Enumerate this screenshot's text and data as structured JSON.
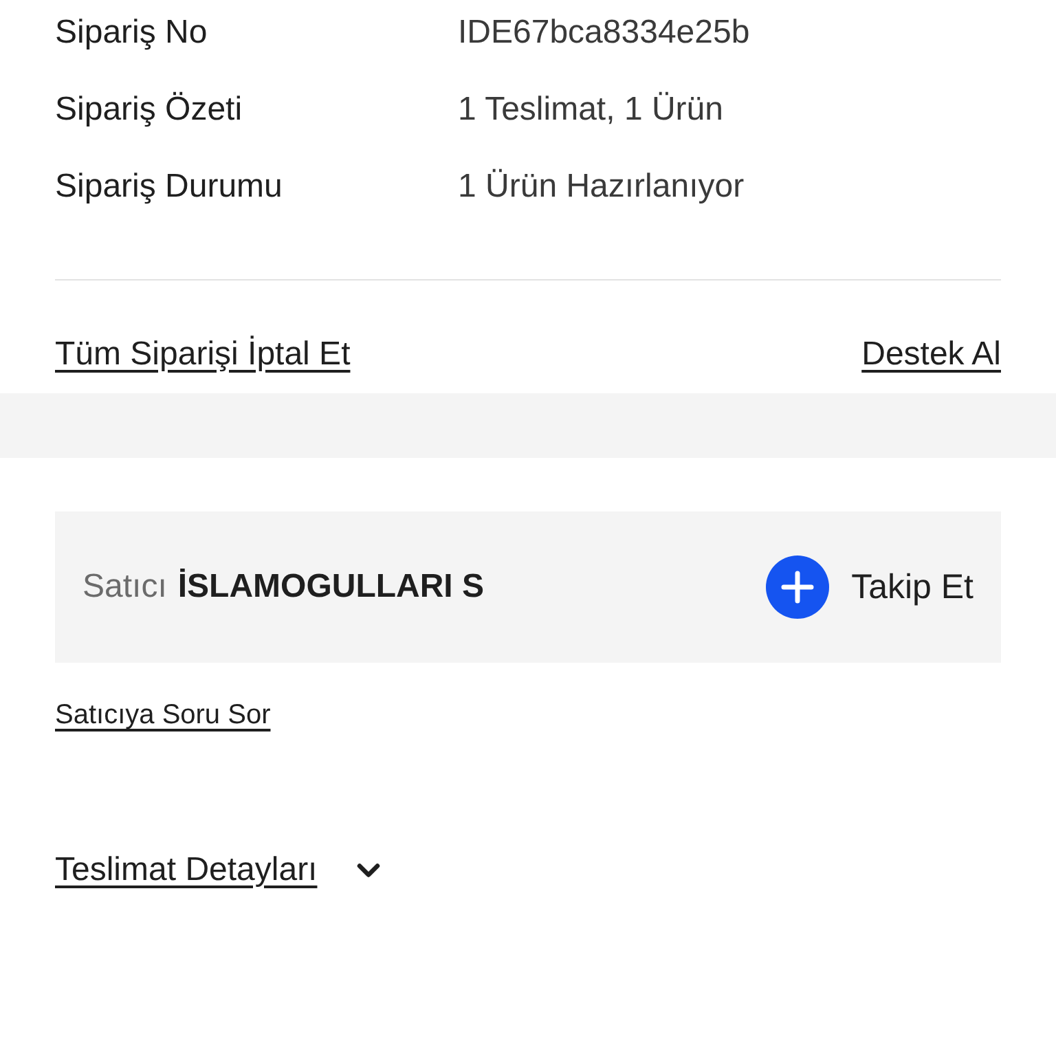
{
  "order_summary": {
    "rows": [
      {
        "label": "Sipariş No",
        "value": "IDE67bca8334e25b"
      },
      {
        "label": "Sipariş Özeti",
        "value": "1 Teslimat, 1 Ürün"
      },
      {
        "label": "Sipariş Durumu",
        "value": "1 Ürün Hazırlanıyor"
      }
    ]
  },
  "actions": {
    "cancel_link": "Tüm Siparişi İptal Et",
    "support_link": "Destek Al"
  },
  "seller": {
    "label": "Satıcı",
    "name": "İSLAMOGULLARI S",
    "follow_button": "Takip Et"
  },
  "ask_seller_link": "Satıcıya Soru Sor",
  "delivery_details": {
    "label": "Teslimat Detayları",
    "expanded": false
  }
}
